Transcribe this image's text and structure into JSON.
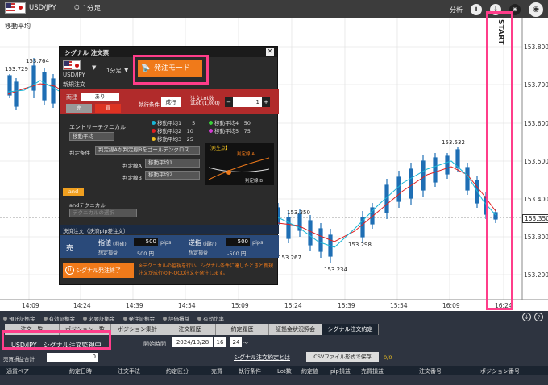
{
  "topbar": {
    "pair": "USD/JPY",
    "timeframe": "1分足",
    "analysis": "分析"
  },
  "chart": {
    "indicator": "移動平均",
    "y_ticks": [
      "153.800",
      "153.700",
      "153.600",
      "153.500",
      "153.400",
      "153.300",
      "153.200"
    ],
    "x_ticks": [
      "14:09",
      "14:24",
      "14:39",
      "14:54",
      "15:09",
      "15:24",
      "15:39",
      "15:54",
      "16:09",
      "16:24"
    ],
    "current_price": "153.350",
    "annotations": {
      "a1": "153.729",
      "a2": "153.764",
      "a3": "153.532",
      "a4": "153.350",
      "a5": "153.267",
      "a6": "153.298",
      "a7": "153.234"
    },
    "start_label": "START"
  },
  "modal": {
    "title": "シグナル 注文票",
    "pair": "USD/JPY",
    "timeframe": "1分足",
    "mode_button": "発注モード",
    "new_order": "新規注文",
    "ryoudate": "両建",
    "ari": "あり",
    "sell": "売",
    "buy": "買",
    "exec_cond_label": "執行条件",
    "exec_cond": "成行",
    "lot_label": "注文Lot数",
    "lot_sub": "1Lot (1,000)",
    "lot_value": "1",
    "entry_label": "エントリーテクニカル",
    "entry_value": "移動平均",
    "ma1": "移動平均1",
    "ma1v": "5",
    "ma2": "移動平均2",
    "ma2v": "10",
    "ma3": "移動平均3",
    "ma3v": "25",
    "ma4": "移動平均4",
    "ma4v": "50",
    "ma5": "移動平均5",
    "ma5v": "75",
    "judge_label": "判定条件",
    "judge_value": "判定線Aが判定線Bをゴールデンクロス",
    "lineA_label": "判定線A",
    "lineA_value": "移動平均1",
    "lineB_label": "判定線B",
    "lineB_value": "移動平均2",
    "trigger": "【発生点】",
    "lineA_short": "判定線 A",
    "lineB_short": "判定線 B",
    "and_tag": "and",
    "and_tech": "andテクニカル",
    "and_select": "テクニカルの選択",
    "settle_title": "決済注文（決済pip差注文）",
    "settle_side": "売",
    "limit_label": "指値",
    "limit_sub": "(利確)",
    "limit_pips": "500",
    "pips": "pips",
    "limit_est_label": "想定損益",
    "limit_est": "500 円",
    "stop_label": "逆指",
    "stop_sub": "(損切)",
    "stop_pips": "500",
    "stop_est_label": "想定損益",
    "stop_est": "-500 円",
    "end_button": "シグナル発注終了",
    "note": "※テクニカルの監視を行い、シグナル条件に達したときと新規注文が成行のIF-OCO注文を発注します。"
  },
  "bottom": {
    "stats": [
      "預託証拠金",
      "有効証拠金",
      "必要証拠金",
      "発注証拠金",
      "評価損益",
      "有効比率"
    ],
    "tabs": [
      "注文一覧",
      "ポジション一覧",
      "ポジション集計",
      "注文履歴",
      "約定履歴",
      "証拠金状況照会",
      "シグナル注文約定"
    ],
    "status": "USD/JPY　シグナル注文監視中",
    "pl_total_label": "売買損益合計",
    "pl_total": "0",
    "start_time_label": "開始時間",
    "date": "2024/10/28",
    "hour": "16",
    "minute": "24",
    "tilde": "〜",
    "link": "シグナル注文約定とは",
    "csv": "CSVファイル形式で保存",
    "count": "0/0",
    "columns": [
      "通貨ペア",
      "約定日時",
      "注文手法",
      "約定区分",
      "売買",
      "執行条件",
      "Lot数",
      "約定値",
      "pip損益",
      "売買損益",
      "注文番号",
      "ポジション番号"
    ]
  }
}
